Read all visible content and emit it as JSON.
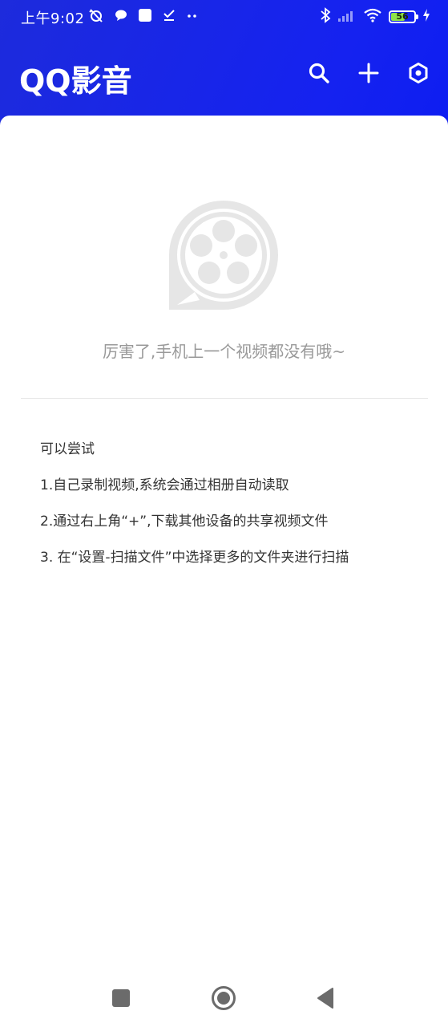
{
  "status_bar": {
    "time": "上午9:02",
    "battery": "56"
  },
  "app_bar": {
    "title": "QQ影音",
    "actions": {
      "search": "search-icon",
      "add": "plus-icon",
      "settings": "settings-icon"
    }
  },
  "empty_state": {
    "icon": "video-reel-icon",
    "message": "厉害了,手机上一个视频都没有哦~"
  },
  "tips": {
    "heading": "可以尝试",
    "items": [
      "1.自己录制视频,系统会通过相册自动读取",
      "2.通过右上角“+”,下载其他设备的共享视频文件",
      "3. 在“设置-扫描文件”中选择更多的文件夹进行扫描"
    ]
  },
  "colors": {
    "header_blue": "#1522f0",
    "muted_text": "#999999",
    "body_text": "#333333",
    "icon_grey": "#e6e6e6",
    "nav_grey": "#6b6b6b"
  }
}
